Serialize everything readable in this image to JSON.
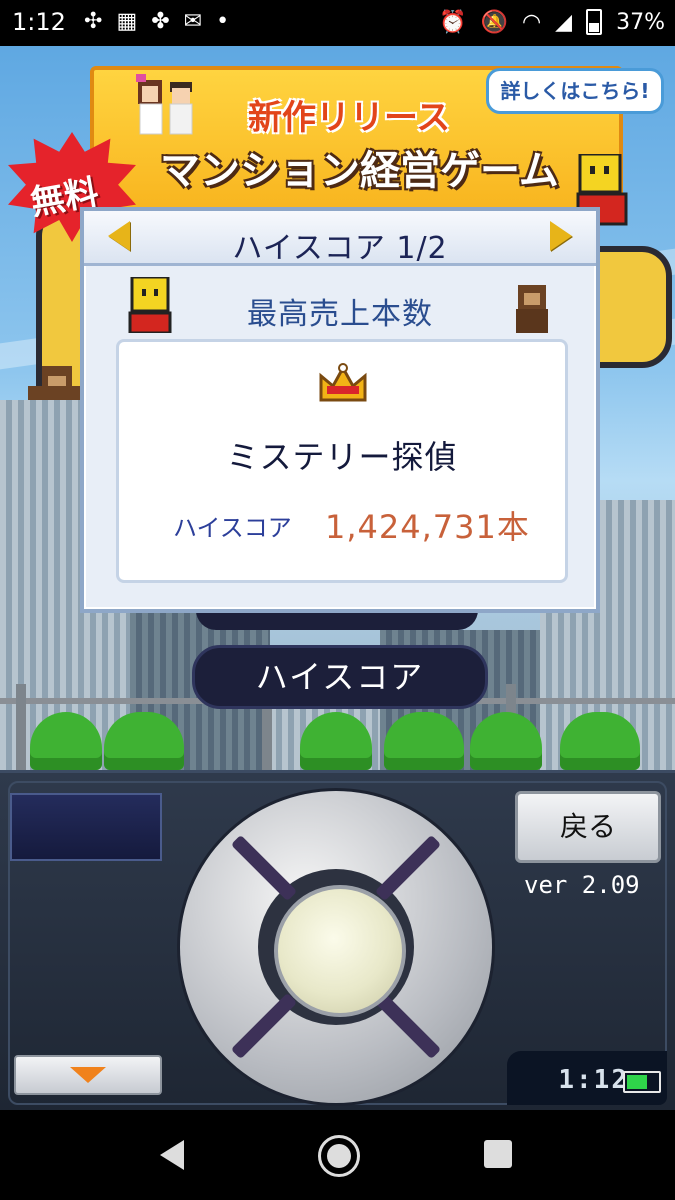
{
  "status_bar": {
    "time": "1:12",
    "battery": "37%",
    "icons": [
      "pinwheel-icon",
      "app-grid-icon",
      "fan-icon",
      "mail-icon",
      "dot-icon",
      "alarm-icon",
      "mute-icon",
      "wifi-icon",
      "signal-icon",
      "battery-icon"
    ]
  },
  "ad": {
    "badge": "無料",
    "line1": "新作リリース",
    "line2": "マンション経営ゲーム",
    "details": "詳しくはこちら!"
  },
  "dialog": {
    "title": "ハイスコア 1/2",
    "subtitle": "最高売上本数",
    "game_title": "ミステリー探偵",
    "highscore_label": "ハイスコア",
    "highscore_value": "1,424,731本"
  },
  "menu": {
    "button": "ハイスコア"
  },
  "panel": {
    "back_button": "戻る",
    "version": "ver 2.09",
    "clock": "1:12",
    "accent": "#f0821c"
  }
}
